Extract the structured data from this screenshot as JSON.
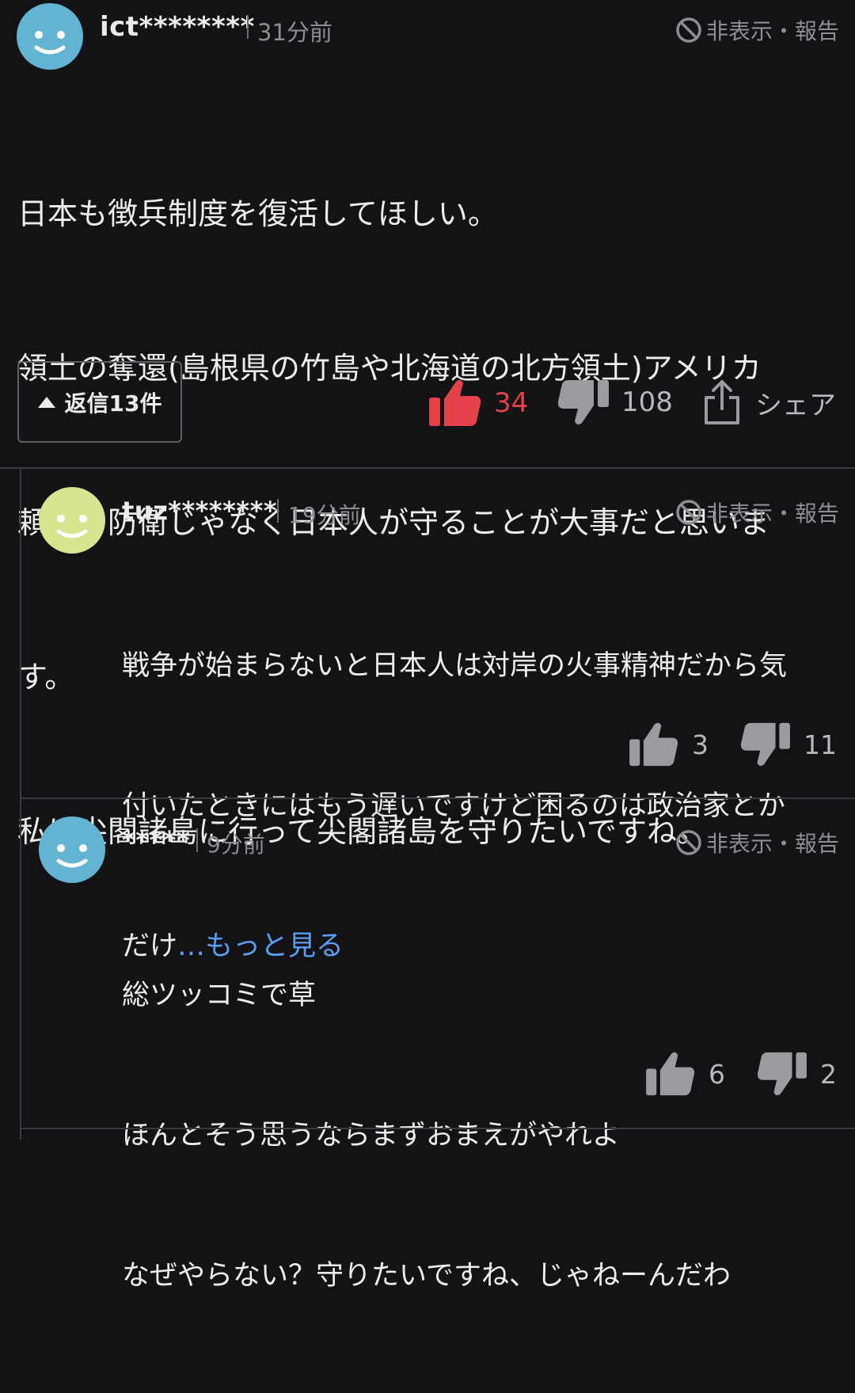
{
  "main_comment": {
    "username": "ict********",
    "time": "31分前",
    "report_label": "非表示・報告",
    "lines": [
      "日本も徴兵制度を復活してほしい。",
      "領土の奪還(島根県の竹島や北海道の北方領土)アメリカ",
      "頼りの防衛じゃなく日本人が守ることが大事だと思いま",
      "す。",
      "私は尖閣諸島に行って尖閣諸島を守りたいですね。"
    ],
    "reply_button_label": "返信13件",
    "likes": "34",
    "dislikes": "108",
    "share_label": "シェア",
    "avatar_color": "#63b3d3"
  },
  "replies": [
    {
      "username": "tuz********",
      "time": "19分前",
      "report_label": "非表示・報告",
      "lines": [
        "戦争が始まらないと日本人は対岸の火事精神だから気",
        "付いたときにはもう遅いですけど困るのは政治家とか"
      ],
      "last_line_text": "だけ",
      "more_label": "…もっと見る",
      "likes": "3",
      "dislikes": "11",
      "avatar_color": "#d7e58f"
    },
    {
      "username": "*****",
      "time": "9分前",
      "report_label": "非表示・報告",
      "lines": [
        "総ツッコミで草",
        "ほんとそう思うならまずおまえがやれよ",
        "なぜやらない？守りたいですね、じゃねーんだわ"
      ],
      "likes": "6",
      "dislikes": "2",
      "avatar_color": "#63b3d3"
    }
  ],
  "colors": {
    "background": "#131315",
    "like_active": "#e5414b",
    "icon_gray": "#9b9ba0",
    "link_blue": "#5b9ef0"
  },
  "icons": {
    "avatar": "smiley-face-icon",
    "hide": "prohibited-icon",
    "like": "thumbs-up-icon",
    "dislike": "thumbs-down-icon",
    "share": "share-icon",
    "reply_toggle": "triangle-up-icon"
  }
}
